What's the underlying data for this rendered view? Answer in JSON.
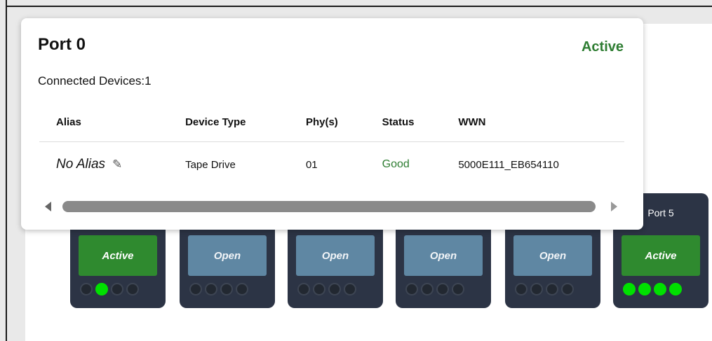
{
  "popup": {
    "title": "Port 0",
    "status": "Active",
    "connected_label": "Connected Devices:",
    "connected_count": "1",
    "columns": [
      "Alias",
      "Device Type",
      "Phy(s)",
      "Status",
      "WWN"
    ],
    "rows": [
      {
        "alias": "No Alias",
        "device_type": "Tape Drive",
        "phys": "01",
        "status": "Good",
        "wwn": "5000E111_EB654110"
      }
    ]
  },
  "ports": [
    {
      "label": "",
      "state": "Active",
      "leds": [
        false,
        true,
        false,
        false
      ]
    },
    {
      "label": "",
      "state": "Open",
      "leds": [
        false,
        false,
        false,
        false
      ]
    },
    {
      "label": "",
      "state": "Open",
      "leds": [
        false,
        false,
        false,
        false
      ]
    },
    {
      "label": "",
      "state": "Open",
      "leds": [
        false,
        false,
        false,
        false
      ]
    },
    {
      "label": "",
      "state": "Open",
      "leds": [
        false,
        false,
        false,
        false
      ]
    },
    {
      "label": "Port 5",
      "state": "Active",
      "leds": [
        true,
        true,
        true,
        true
      ]
    }
  ],
  "colors": {
    "active_text": "#2e7d32",
    "port_active": "#2f8a2f",
    "port_open": "#5f87a3",
    "led_on": "#00e000",
    "card_bg": "#2c3445"
  }
}
